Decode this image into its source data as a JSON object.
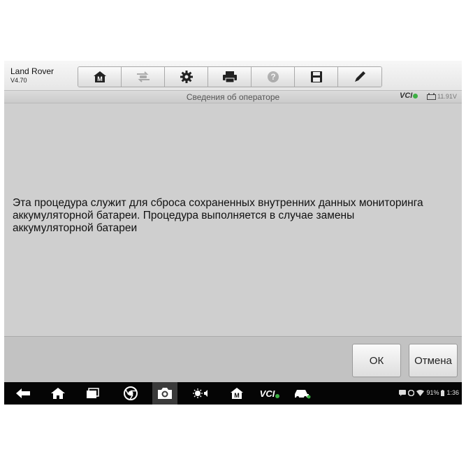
{
  "header": {
    "vehicle_name": "Land Rover",
    "version": "V4.70",
    "toolbar": [
      {
        "icon": "home-m-icon",
        "enabled": true
      },
      {
        "icon": "vehicle-swap-icon",
        "enabled": false
      },
      {
        "icon": "gear-icon",
        "enabled": true
      },
      {
        "icon": "printer-icon",
        "enabled": true
      },
      {
        "icon": "help-icon",
        "enabled": false
      },
      {
        "icon": "save-icon",
        "enabled": true
      },
      {
        "icon": "pencil-icon",
        "enabled": true
      }
    ]
  },
  "titlebar": {
    "title": "Сведения об операторе",
    "vci_label": "VCI",
    "battery_voltage": "11.91V"
  },
  "content": {
    "message": "Эта процедура служит для сброса сохраненных внутренних данных мониторинга\nаккумуляторной батареи. Процедура выполняется в случае замены\nаккумуляторной батареи"
  },
  "footer": {
    "ok_label": "ОК",
    "cancel_label": "Отмена"
  },
  "navbar": {
    "vci_label": "VCI",
    "battery_percent": "91%",
    "time": "1:36"
  },
  "colors": {
    "screen_bg": "#cfcfcf",
    "vci_connected": "#3cb043",
    "navbar_bg": "#050505"
  }
}
